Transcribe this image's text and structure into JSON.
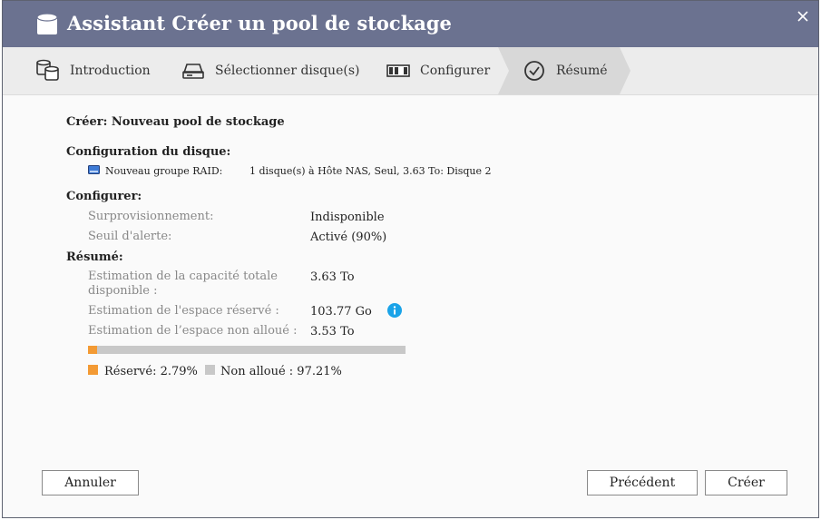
{
  "window": {
    "title": "Assistant Créer un pool de stockage"
  },
  "steps": [
    {
      "label": "Introduction"
    },
    {
      "label": "Sélectionner disque(s)"
    },
    {
      "label": "Configurer"
    },
    {
      "label": "Résumé",
      "active": true
    }
  ],
  "summary": {
    "heading": "Créer: Nouveau pool de stockage",
    "disk_config": {
      "heading": "Configuration du disque:",
      "group_label": "Nouveau groupe RAID:",
      "group_value": "1 disque(s) à Hôte NAS, Seul, 3.63 To: Disque 2"
    },
    "configure": {
      "heading": "Configurer:",
      "overprovisioning_label": "Surprovisionnement:",
      "overprovisioning_value": "Indisponible",
      "alert_label": "Seuil d'alerte:",
      "alert_value": "Activé (90%)"
    },
    "resume": {
      "heading": "Résumé:",
      "total_label_line1": "Estimation de la capacité totale",
      "total_label_line2": "disponible  :",
      "total_value": "3.63 To",
      "reserved_label": "Estimation de l'espace réservé  :",
      "reserved_value": "103.77 Go",
      "unallocated_label": "Estimation de l’espace non alloué  :",
      "unallocated_value": "3.53 To"
    },
    "usage": {
      "reserved_fraction": 0.0279,
      "reserved_color": "#f39a34",
      "unallocated_color": "#c8c8c8",
      "legend_reserved": "Réservé: 2.79%",
      "legend_unallocated": "Non alloué  : 97.21%"
    }
  },
  "buttons": {
    "cancel": "Annuler",
    "previous": "Précédent",
    "create": "Créer"
  },
  "colors": {
    "titlebar": "#6b7290",
    "info": "#1aa3e8"
  }
}
